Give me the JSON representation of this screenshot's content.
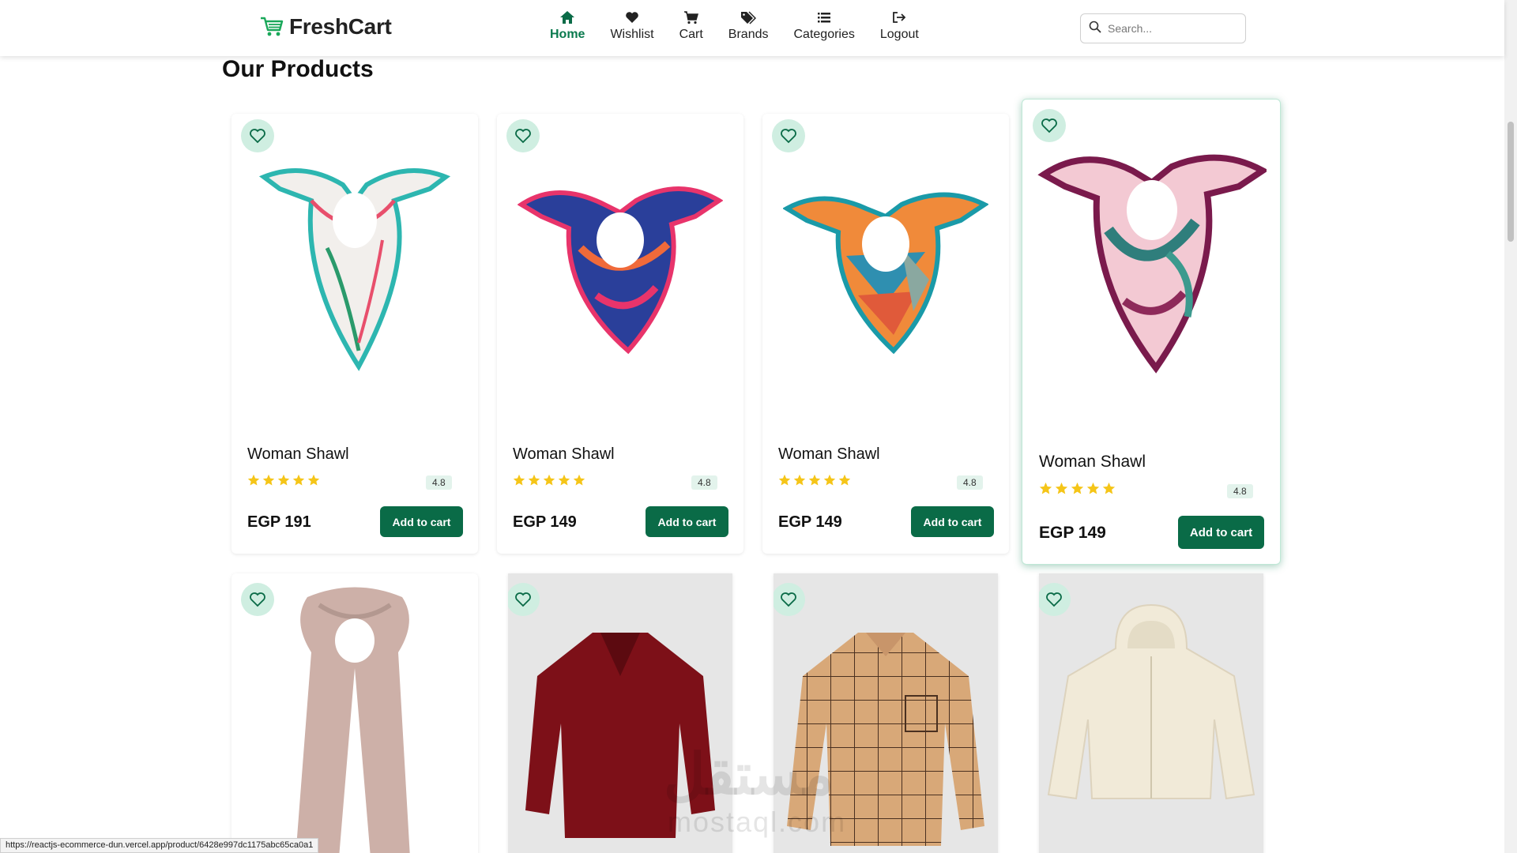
{
  "brand": {
    "name": "FreshCart"
  },
  "nav": [
    {
      "label": "Home",
      "icon": "home-icon",
      "active": true
    },
    {
      "label": "Wishlist",
      "icon": "heart-icon",
      "active": false
    },
    {
      "label": "Cart",
      "icon": "cart-icon",
      "active": false
    },
    {
      "label": "Brands",
      "icon": "tags-icon",
      "active": false
    },
    {
      "label": "Categories",
      "icon": "list-icon",
      "active": false
    },
    {
      "label": "Logout",
      "icon": "logout-icon",
      "active": false
    }
  ],
  "search": {
    "placeholder": "Search..."
  },
  "section": {
    "title": "Our Products"
  },
  "products": [
    {
      "title": "Woman Shawl",
      "price": "EGP 191",
      "rating": "4.8",
      "button": "Add to cart",
      "stars": 5
    },
    {
      "title": "Woman Shawl",
      "price": "EGP 149",
      "rating": "4.8",
      "button": "Add to cart",
      "stars": 5
    },
    {
      "title": "Woman Shawl",
      "price": "EGP 149",
      "rating": "4.8",
      "button": "Add to cart",
      "stars": 5
    },
    {
      "title": "Woman Shawl",
      "price": "EGP 149",
      "rating": "4.8",
      "button": "Add to cart",
      "stars": 5
    }
  ],
  "status": {
    "url": "https://reactjs-ecommerce-dun.vercel.app/product/6428e997dc1175abc65ca0a1"
  },
  "watermark": {
    "arabic": "مستقل",
    "latin": "mostaql.com"
  },
  "colors": {
    "accent": "#0a6b47",
    "heart_bg": "#cfeee1",
    "star": "#f5c518"
  }
}
